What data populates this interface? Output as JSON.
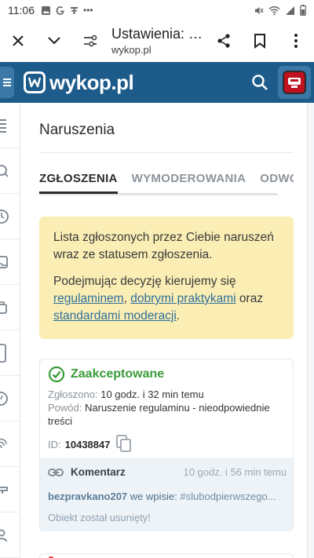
{
  "status_bar": {
    "time": "11:06",
    "left_icons": [
      "image-icon",
      "google-icon",
      "fan-icon",
      "more-dots-icon"
    ],
    "right_icons": [
      "mute-icon",
      "wifi-icon",
      "signal-icon",
      "battery-icon"
    ]
  },
  "browser": {
    "title": "Ustawienia: N...",
    "url": "wykop.pl",
    "icons": [
      "close-icon",
      "chevron-down-icon",
      "site-settings-icon",
      "share-icon",
      "bookmark-icon",
      "menu-dots-icon"
    ]
  },
  "header": {
    "logo_text": "wykop.pl",
    "bg_color": "#1d5b8a"
  },
  "sidebar": {
    "icons": [
      "list-icon",
      "search-icon",
      "clock-icon",
      "inbox-icon",
      "bag-icon",
      "device-icon",
      "history-icon",
      "fingerprint-icon",
      "tools-icon",
      "user-icon"
    ]
  },
  "page": {
    "title": "Naruszenia",
    "tabs": [
      {
        "label": "ZGŁOSZENIA",
        "active": true
      },
      {
        "label": "WYMODEROWANIA",
        "active": false
      },
      {
        "label": "ODWOŁANIA",
        "active": false
      }
    ]
  },
  "notice": {
    "line1": "Lista zgłoszonych przez Ciebie naruszeń wraz ze statusem zgłoszenia.",
    "line2_prefix": "Podejmując decyzję kierujemy się ",
    "link1": "regulaminem",
    "sep1": ", ",
    "link2": "dobrymi praktykami",
    "sep2": " oraz ",
    "link3": "standardami moderacji",
    "end": ".",
    "bg_color": "#fbeeb4"
  },
  "report": {
    "status": "Zaakceptowane",
    "status_color": "#3a9b3a",
    "reported_label": "Zgłoszono:",
    "reported_value": "10 godz. i 32 min temu",
    "reason_label": "Powód:",
    "reason_value": "Naruszenie regulaminu - nieodpowiednie treści",
    "id_label": "ID:",
    "id_value": "10438847",
    "comment": {
      "title": "Komentarz",
      "time": "10 godz. i 56 min temu",
      "user": "bezpravkano207",
      "mid_text": "we wpisie:",
      "tag": "#slubodpierwszego...",
      "removed": "Obiekt został usunięty!"
    }
  }
}
